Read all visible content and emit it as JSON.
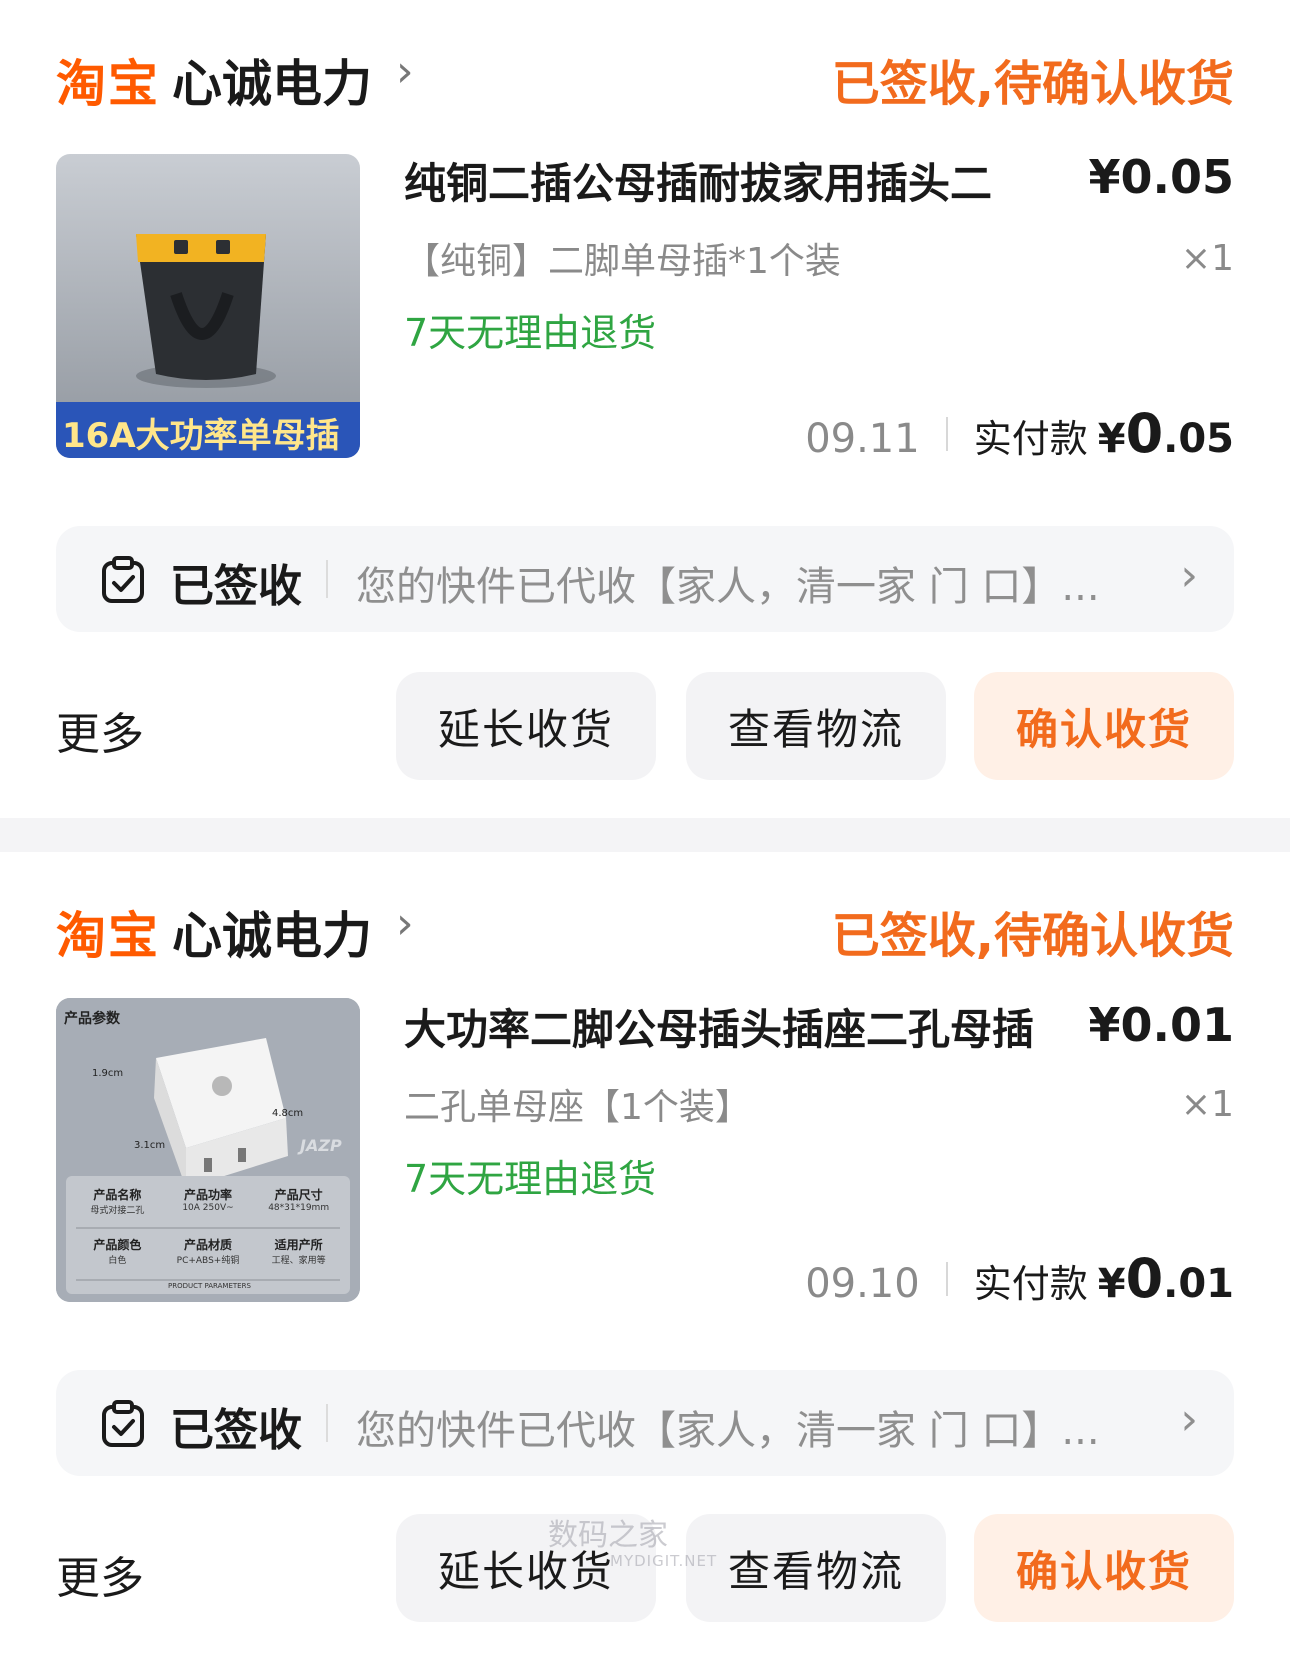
{
  "orders": [
    {
      "platform": "淘宝",
      "shop_name": "心诚电力",
      "shop_chevron": "›",
      "status": "已签收,待确认收货",
      "thumb_caption": "16A大功率单母插",
      "title": "纯铜二插公母插耐拔家用插头二",
      "price": "¥0.05",
      "sku": "【纯铜】二脚单母插*1个装",
      "qty": "×1",
      "refund_policy": "7天无理由退货",
      "date": "09.11",
      "paid_label": "实付款",
      "paid_currency": "¥",
      "paid_int": "0",
      "paid_dec": ".05",
      "logistics_status": "已签收",
      "logistics_text": "您的快件已代收【家人，清一家 门 口】...",
      "logistics_chevron": "›",
      "more_label": "更多",
      "btn_extend": "延长收货",
      "btn_track": "查看物流",
      "btn_confirm": "确认收货"
    },
    {
      "platform": "淘宝",
      "shop_name": "心诚电力",
      "shop_chevron": "›",
      "status": "已签收,待确认收货",
      "thumb_header": "产品参数",
      "thumb_dims": [
        "1.9cm",
        "4.8cm",
        "3.1cm"
      ],
      "thumb_brand": "JAZP",
      "thumb_table": [
        {
          "k": "产品名称",
          "v": "母式对接二孔"
        },
        {
          "k": "产品功率",
          "v": "10A 250V~"
        },
        {
          "k": "产品尺寸",
          "v": "48*31*19mm"
        },
        {
          "k": "产品颜色",
          "v": "白色"
        },
        {
          "k": "产品材质",
          "v": "PC+ABS+纯铜"
        },
        {
          "k": "适用产所",
          "v": "工程、家用等"
        }
      ],
      "thumb_footer": "PRODUCT PARAMETERS",
      "title": "大功率二脚公母插头插座二孔母插",
      "price": "¥0.01",
      "sku": "二孔单母座【1个装】",
      "qty": "×1",
      "refund_policy": "7天无理由退货",
      "date": "09.10",
      "paid_label": "实付款",
      "paid_currency": "¥",
      "paid_int": "0",
      "paid_dec": ".01",
      "logistics_status": "已签收",
      "logistics_text": "您的快件已代收【家人，清一家 门 口】...",
      "logistics_chevron": "›",
      "more_label": "更多",
      "btn_extend": "延长收货",
      "btn_track": "查看物流",
      "btn_confirm": "确认收货"
    }
  ],
  "watermark": {
    "text": "数码之家",
    "sub": "MYDIGIT.NET"
  },
  "colors": {
    "accent": "#f26b1d",
    "brand": "#ff5a00",
    "refund": "#2fa542",
    "muted": "#8a8a8a"
  }
}
